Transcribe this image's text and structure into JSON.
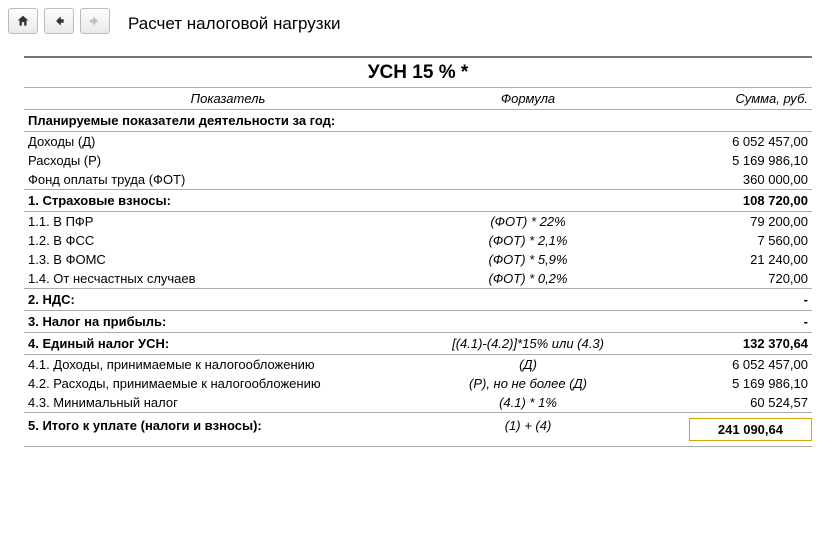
{
  "toolbar": {
    "home": "home",
    "back": "back",
    "forward": "forward"
  },
  "title": "Расчет налоговой нагрузки",
  "heading": "УСН 15 % *",
  "columns": {
    "indicator": "Показатель",
    "formula": "Формула",
    "sum": "Сумма, руб."
  },
  "plan_header": "Планируемые показатели деятельности за год:",
  "plan_rows": [
    {
      "label": "Доходы (Д)",
      "formula": "",
      "sum": "6 052 457,00"
    },
    {
      "label": "Расходы (Р)",
      "formula": "",
      "sum": "5 169 986,10"
    },
    {
      "label": "Фонд оплаты труда (ФОТ)",
      "formula": "",
      "sum": "360 000,00"
    }
  ],
  "sec1": {
    "label": "1. Страховые взносы:",
    "sum": "108 720,00"
  },
  "sec1_rows": [
    {
      "label": "1.1. В ПФР",
      "formula": "(ФОТ) * 22%",
      "sum": "79 200,00"
    },
    {
      "label": "1.2. В ФСС",
      "formula": "(ФОТ) * 2,1%",
      "sum": "7 560,00"
    },
    {
      "label": "1.3. В ФОМС",
      "formula": "(ФОТ) * 5,9%",
      "sum": "21 240,00"
    },
    {
      "label": "1.4. От несчастных случаев",
      "formula": "(ФОТ) * 0,2%",
      "sum": "720,00"
    }
  ],
  "sec2": {
    "label": "2. НДС:",
    "sum": "-"
  },
  "sec3": {
    "label": "3. Налог на прибыль:",
    "sum": "-"
  },
  "sec4": {
    "label": "4. Единый налог УСН:",
    "formula": "[(4.1)-(4.2)]*15% или (4.3)",
    "sum": "132 370,64"
  },
  "sec4_rows": [
    {
      "label": "4.1. Доходы, принимаемые к налогообложению",
      "formula": "(Д)",
      "sum": "6 052 457,00"
    },
    {
      "label": "4.2. Расходы, принимаемые к налогообложению",
      "formula": "(Р), но не более (Д)",
      "sum": "5 169 986,10"
    },
    {
      "label": "4.3. Минимальный налог",
      "formula": "(4.1) * 1%",
      "sum": "60 524,57"
    }
  ],
  "sec5": {
    "label": "5. Итого к уплате (налоги и взносы):",
    "formula": "(1) + (4)",
    "sum": "241 090,64"
  }
}
